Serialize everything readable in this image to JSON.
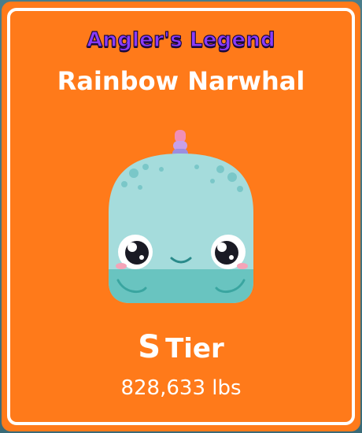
{
  "card": {
    "subtitle": "Angler's Legend",
    "title": "Rainbow Narwhal",
    "tier_letter": "S",
    "tier_label": "Tier",
    "weight": "828,633 lbs",
    "fish_icon": "rainbow-narwhal-icon",
    "colors": {
      "card_bg": "#ff7a1a",
      "border": "#ffffff",
      "subtitle": "#8b3cff",
      "text": "#ffffff"
    }
  }
}
